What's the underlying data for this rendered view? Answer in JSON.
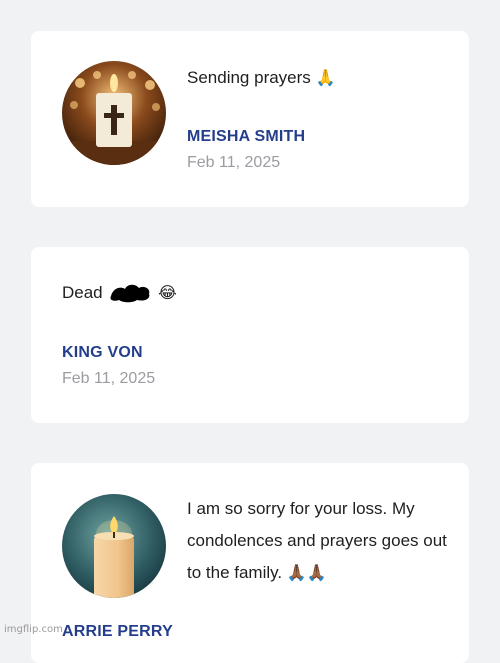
{
  "comments": [
    {
      "message": "Sending prayers",
      "emoji": "🙏",
      "author": "MEISHA SMITH",
      "date": "Feb 11, 2025",
      "avatar_icon": "candle-cross-icon"
    },
    {
      "message_prefix": "Dead",
      "emoji": "😂",
      "author": "KING VON",
      "date": "Feb 11, 2025"
    },
    {
      "message": "I am so sorry for your loss. My condolences and prayers goes out to the family.",
      "emoji": "🙏🏾🙏🏾",
      "author": "ARRIE PERRY",
      "avatar_icon": "candle-icon"
    }
  ],
  "watermark": "imgflip.com",
  "colors": {
    "page_bg": "#f1f2f4",
    "card_bg": "#ffffff",
    "author": "#243e8c",
    "date": "#9a9ca2"
  }
}
